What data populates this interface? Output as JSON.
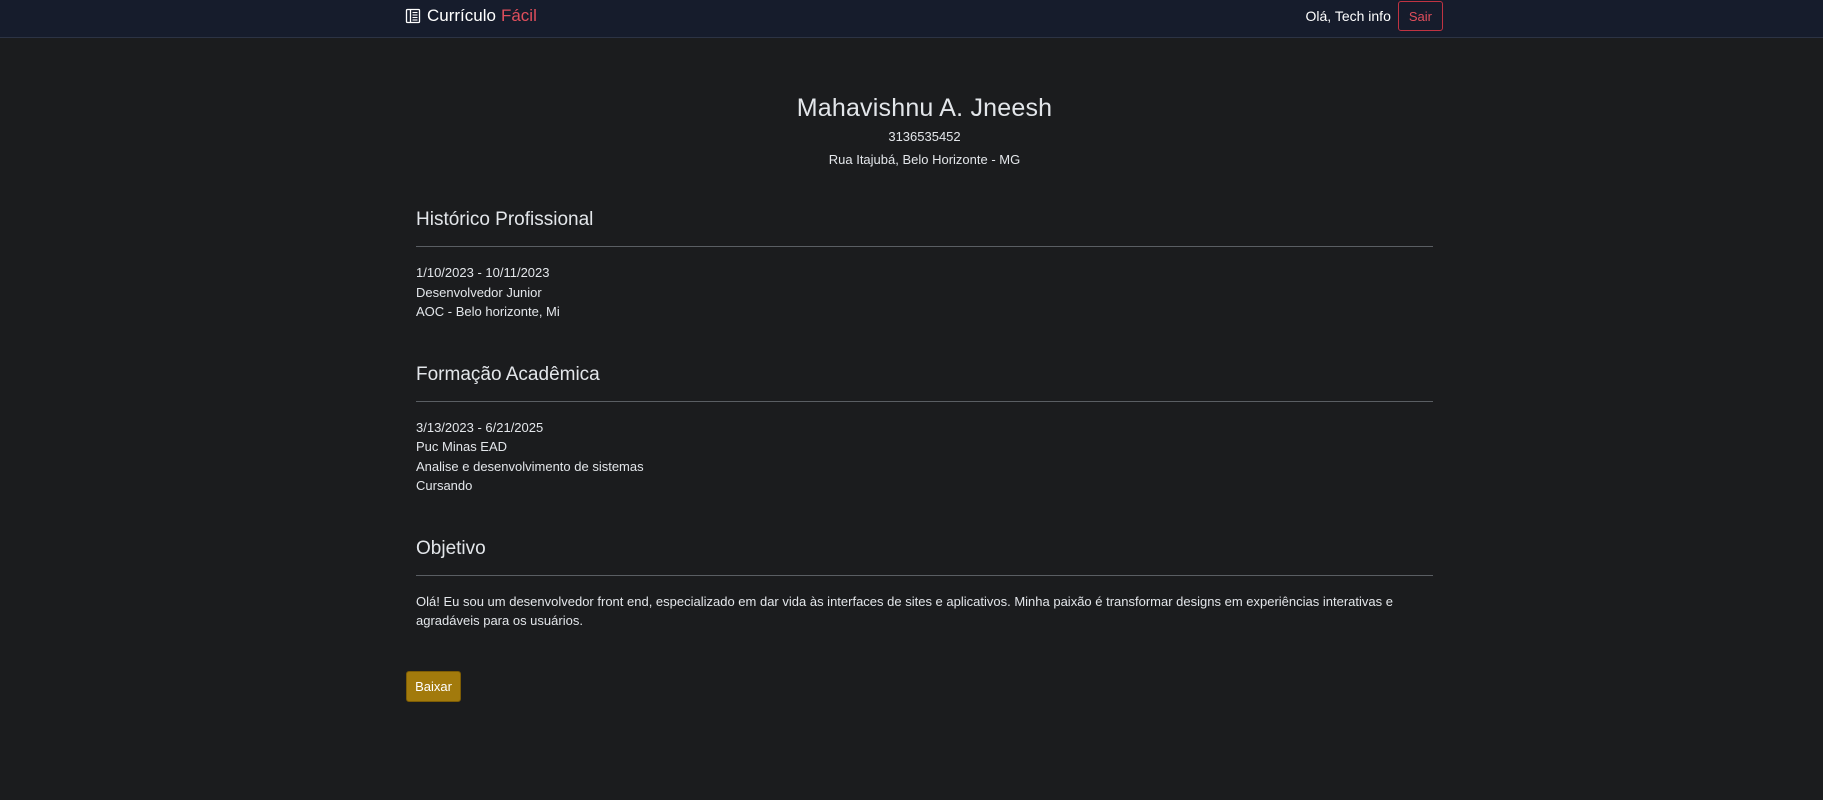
{
  "navbar": {
    "brand_main": "Currículo",
    "brand_accent": "Fácil",
    "brand_icon": "book-icon",
    "greeting": "Olá, Tech info",
    "logout_label": "Sair"
  },
  "profile": {
    "name": "Mahavishnu A. Jneesh",
    "phone": "3136535452",
    "address": "Rua Itajubá, Belo Horizonte - MG"
  },
  "professional": {
    "title": "Histórico Profissional",
    "entries": [
      {
        "period": "1/10/2023 - 10/11/2023",
        "role": "Desenvolvedor Junior",
        "company": "AOC - Belo horizonte, Mi"
      }
    ]
  },
  "education": {
    "title": "Formação Acadêmica",
    "entries": [
      {
        "period": "3/13/2023 - 6/21/2025",
        "institution": "Puc Minas EAD",
        "course": "Analise e desenvolvimento de sistemas",
        "status": "Cursando"
      }
    ]
  },
  "objective": {
    "title": "Objetivo",
    "text": "Olá! Eu sou um desenvolvedor front end, especializado em dar vida às interfaces de sites e aplicativos. Minha paixão é transformar designs em experiências interativas e agradáveis para os usuários."
  },
  "actions": {
    "download_label": "Baixar"
  },
  "colors": {
    "background": "#1b1c1e",
    "navbar": "#161c2c",
    "accent_red": "#e04e5c",
    "download_button": "#a27a0c"
  }
}
